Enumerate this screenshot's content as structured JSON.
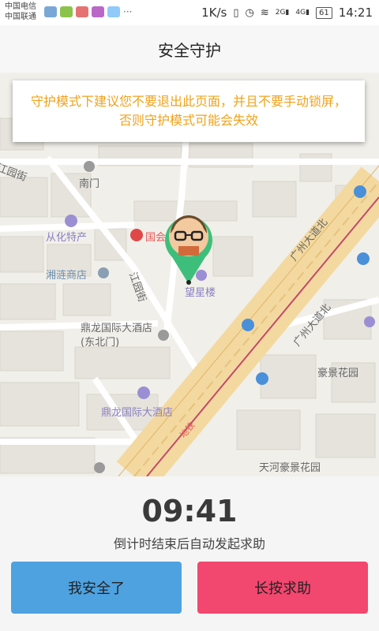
{
  "status_bar": {
    "carrier1": "中国电信",
    "carrier2": "中国联通",
    "speed": "1K/s",
    "signal1": "2G",
    "signal2": "4G",
    "battery": "61",
    "time": "14:21"
  },
  "header": {
    "title": "安全守护"
  },
  "tip": {
    "text": "守护模式下建议您不要退出此页面，并且不要手动锁屏，否则守护模式可能会失效"
  },
  "map": {
    "labels": {
      "yuan_jie": "江园街",
      "nan_men": "南门",
      "cong_hua": "从化特产",
      "xiang_lian": "湘涟商店",
      "guo_shop": "国会",
      "wang_xing": "望星楼",
      "jiang_yuan_jie": "江园街",
      "ding_long_hotel_ne": "鼎龙国际大酒店(东北门)",
      "ding_long_hotel": "鼎龙国际大酒店",
      "guangzhou_road_a": "广州大道北",
      "guangzhou_road_b": "广州大道北",
      "hao_jing": "豪景花园",
      "tianhe_hao_jing": "天河豪景花园",
      "metro": "地铁"
    }
  },
  "countdown": {
    "time": "09:41",
    "hint": "倒计时结束后自动发起求助"
  },
  "buttons": {
    "safe": "我安全了",
    "help": "长按求助"
  },
  "colors": {
    "tip_text": "#f0a21a",
    "safe_button": "#4ea2e0",
    "help_button": "#f2476f",
    "pin": "#3dbf7b"
  }
}
